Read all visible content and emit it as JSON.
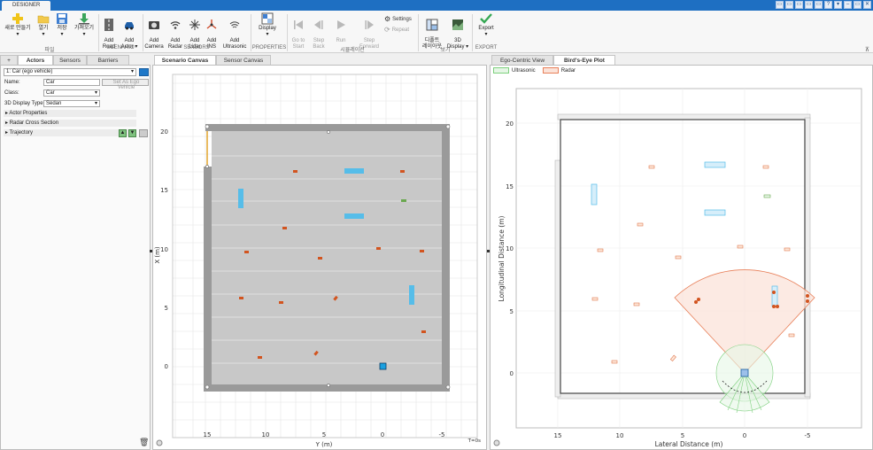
{
  "window": {
    "tab": "DESIGNER",
    "controls": [
      "▭",
      "▭",
      "▭",
      "▭",
      "▭",
      "?",
      "▾",
      "–",
      "▭",
      "✕"
    ]
  },
  "ribbon": {
    "file": {
      "label": "파일",
      "new": "새로 만들기",
      "open": "열기",
      "save": "저장",
      "import": "가져오기"
    },
    "scenario": {
      "label": "SCENARIO",
      "add_road": "Add\nRoad",
      "add_actor": "Add\nActor"
    },
    "sensors": {
      "label": "SENSORS",
      "camera": "Add\nCamera",
      "radar": "Add\nRadar",
      "lidar": "Add\nLidar",
      "ins": "Add\nINS",
      "ultrasonic": "Add\nUltrasonic"
    },
    "properties": {
      "label": "PROPERTIES",
      "display": "Display"
    },
    "simulation": {
      "label": "시뮬레이션",
      "goto_start": "Go to\nStart",
      "step_back": "Step\nBack",
      "run": "Run",
      "step_forward": "Step\nForward",
      "settings": "Settings",
      "repeat": "Repeat"
    },
    "view": {
      "label": "보기",
      "default_layout": "디폴트\n레이아웃",
      "display_3d": "3D\nDisplay"
    },
    "export": {
      "label": "EXPORT",
      "export": "Export"
    }
  },
  "left": {
    "tabs": [
      "Actors",
      "Sensors",
      "Barriers"
    ],
    "plus": "+",
    "actor_select": "1: Car (ego vehicle)",
    "color_swatch": "#1f78c8",
    "name_label": "Name:",
    "name_value": "Car",
    "set_ego": "Set As Ego Vehicle",
    "class_label": "Class:",
    "class_value": "Car",
    "display_type_label": "3D Display Type:",
    "display_type_value": "Sedan",
    "sections": [
      "Actor Properties",
      "Radar Cross Section",
      "Trajectory"
    ]
  },
  "mid": {
    "tabs": [
      "Scenario Canvas",
      "Sensor Canvas"
    ],
    "time": "T=0s",
    "x_label": "X (m)",
    "y_label": "Y (m)",
    "x_ticks": [
      "0",
      "5",
      "10",
      "15",
      "20"
    ],
    "y_ticks": [
      "15",
      "10",
      "5",
      "0",
      "-5"
    ]
  },
  "right": {
    "tabs": [
      "Ego-Centric View",
      "Bird's-Eye Plot"
    ],
    "legend": [
      {
        "name": "Ultrasonic",
        "color": "#7ed07e"
      },
      {
        "name": "Radar",
        "color": "#e8805a"
      }
    ],
    "x_label": "Lateral Distance (m)",
    "y_label": "Longitudinal Distance (m)",
    "x_ticks": [
      "15",
      "10",
      "5",
      "0",
      "-5"
    ],
    "y_ticks": [
      "0",
      "5",
      "10",
      "15",
      "20"
    ]
  },
  "colors": {
    "accent": "#1e6fc2",
    "actor": "#d2541f",
    "ego": "#1aa0e0",
    "truck": "#56bde9",
    "radar": "#e8805a",
    "ultra": "#7ed07e"
  }
}
